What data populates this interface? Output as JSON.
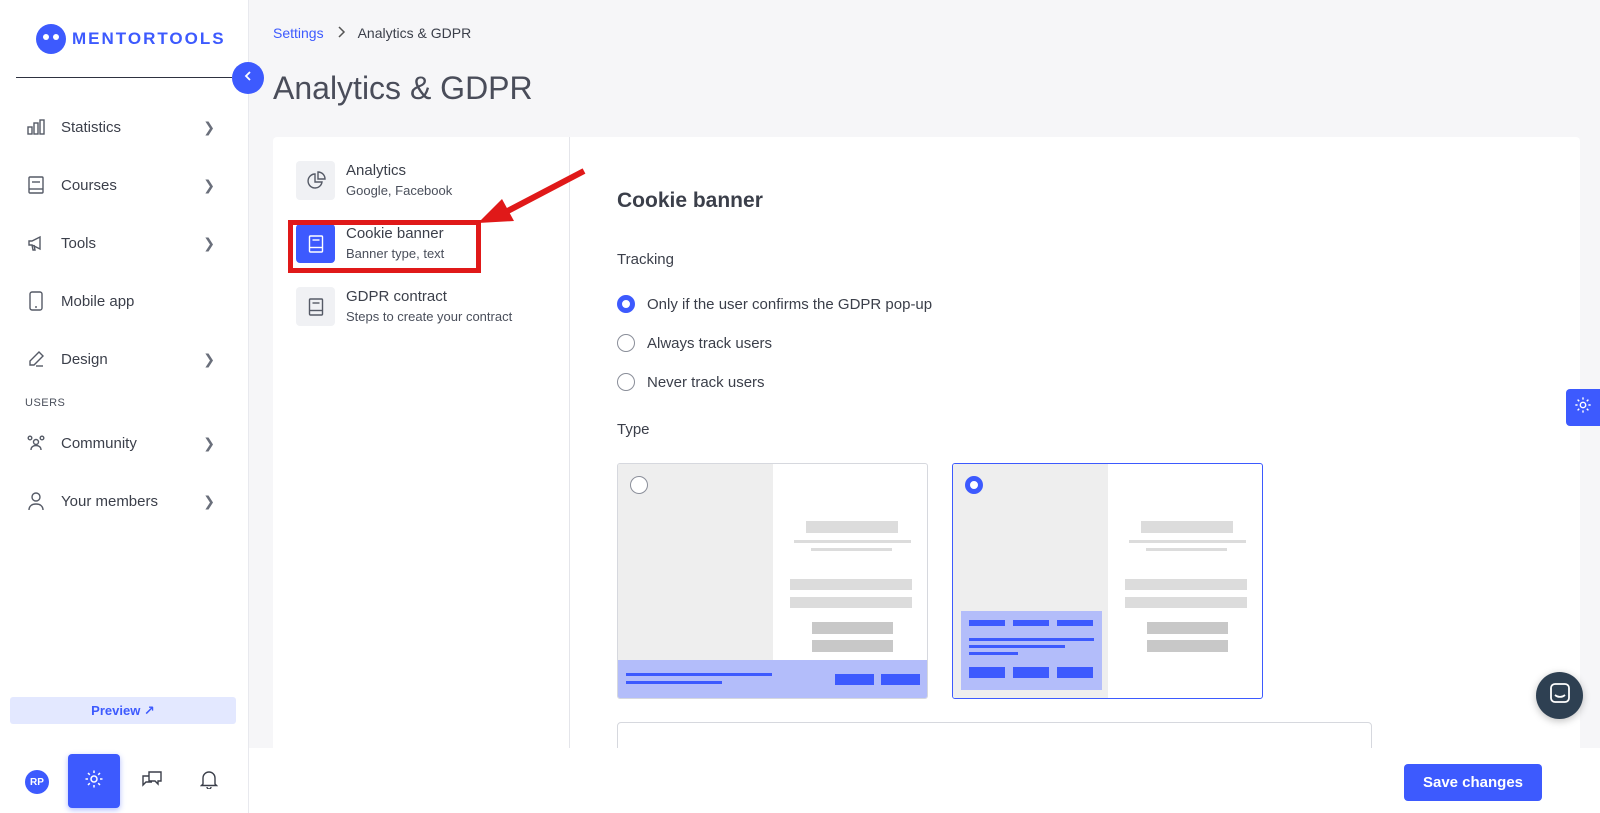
{
  "brand": {
    "name": "MENTORTOOLS"
  },
  "sidebar": {
    "items": [
      {
        "label": "Statistics",
        "icon": "bar-chart-icon"
      },
      {
        "label": "Courses",
        "icon": "book-icon"
      },
      {
        "label": "Tools",
        "icon": "megaphone-icon"
      },
      {
        "label": "Mobile app",
        "icon": "mobile-icon"
      },
      {
        "label": "Design",
        "icon": "pencil-icon"
      }
    ],
    "section_users": "USERS",
    "user_items": [
      {
        "label": "Community",
        "icon": "community-icon"
      },
      {
        "label": "Your members",
        "icon": "user-icon"
      }
    ],
    "preview_label": "Preview ↗",
    "avatar_initials": "RP"
  },
  "breadcrumb": {
    "parent": "Settings",
    "current": "Analytics & GDPR"
  },
  "page_title": "Analytics & GDPR",
  "subnav": [
    {
      "title": "Analytics",
      "desc": "Google, Facebook",
      "icon": "pie-chart-icon"
    },
    {
      "title": "Cookie banner",
      "desc": "Banner type, text",
      "icon": "document-icon",
      "active": true
    },
    {
      "title": "GDPR contract",
      "desc": "Steps to create your contract",
      "icon": "document-icon"
    }
  ],
  "content": {
    "section_title": "Cookie banner",
    "tracking_label": "Tracking",
    "tracking_options": [
      {
        "label": "Only if the user confirms the GDPR pop-up",
        "selected": true
      },
      {
        "label": "Always track users",
        "selected": false
      },
      {
        "label": "Never track users",
        "selected": false
      }
    ],
    "type_label": "Type",
    "type_options": [
      {
        "name": "bottom-bar",
        "selected": false
      },
      {
        "name": "popup-box",
        "selected": true
      }
    ]
  },
  "footer": {
    "save_label": "Save changes"
  },
  "colors": {
    "accent": "#3d5afe",
    "highlight": "#e01919"
  }
}
